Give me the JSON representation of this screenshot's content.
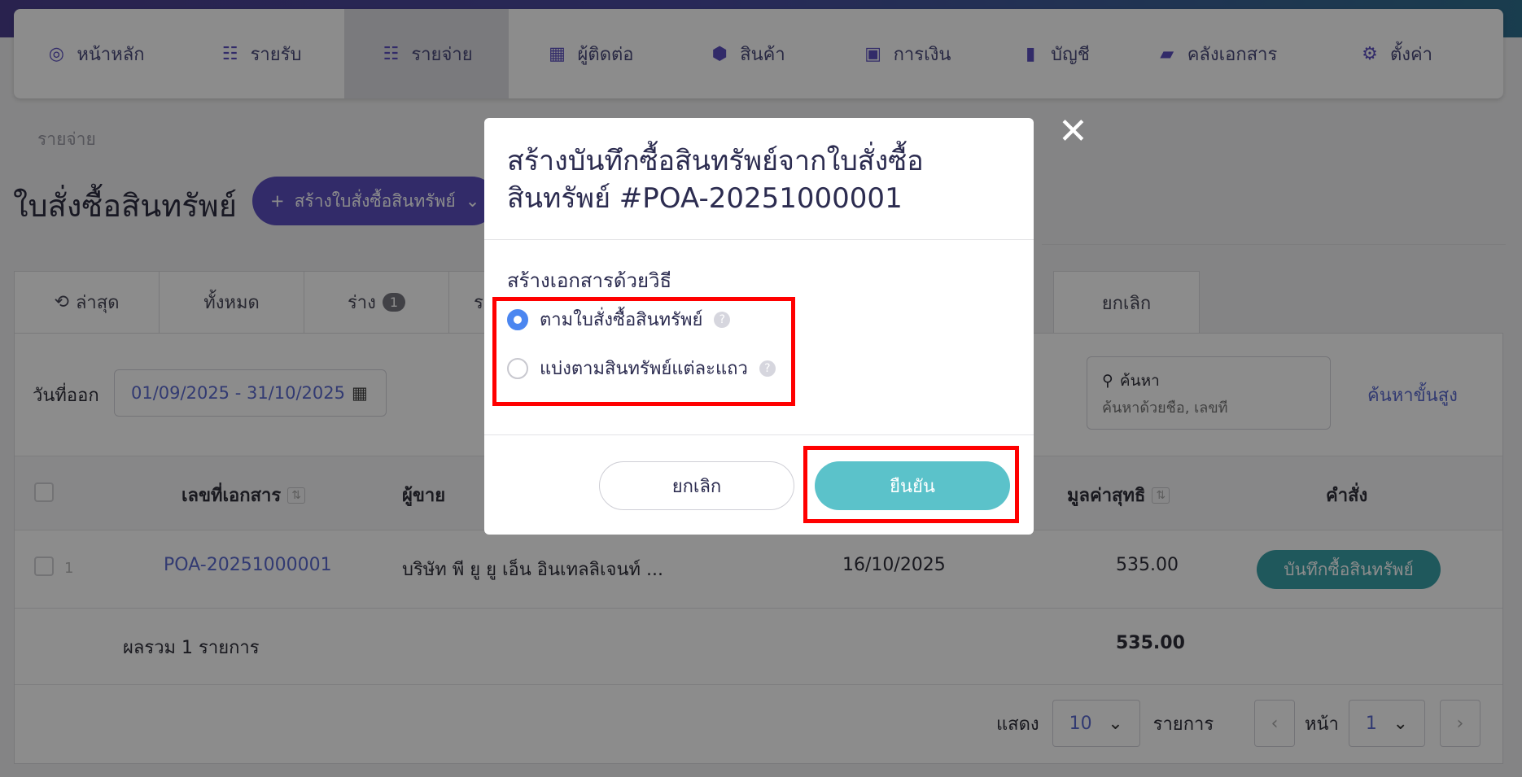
{
  "nav": {
    "items": [
      {
        "label": "หน้าหลัก",
        "icon": "dashboard-icon",
        "glyph": "◎"
      },
      {
        "label": "รายรับ",
        "icon": "income-icon",
        "glyph": "☷"
      },
      {
        "label": "รายจ่าย",
        "icon": "expense-icon",
        "glyph": "☷"
      },
      {
        "label": "ผู้ติดต่อ",
        "icon": "contacts-icon",
        "glyph": "▦"
      },
      {
        "label": "สินค้า",
        "icon": "product-box-icon",
        "glyph": "⬢"
      },
      {
        "label": "การเงิน",
        "icon": "money-icon",
        "glyph": "▣"
      },
      {
        "label": "บัญชี",
        "icon": "ledger-book-icon",
        "glyph": "▮"
      },
      {
        "label": "คลังเอกสาร",
        "icon": "folder-icon",
        "glyph": "▰"
      },
      {
        "label": "ตั้งค่า",
        "icon": "gear-icon",
        "glyph": "⚙"
      }
    ]
  },
  "breadcrumb": "รายจ่าย",
  "page_title": "ใบสั่งซื้อสินทรัพย์",
  "create_button": {
    "label": "สร้างใบสั่งซื้อสินทรัพย์",
    "plus": "+",
    "caret": "⌄"
  },
  "tabs": [
    {
      "label": "ล่าสุด",
      "icon": "⟲"
    },
    {
      "label": "ทั้งหมด"
    },
    {
      "label": "ร่าง",
      "badge": "1"
    },
    {
      "label": "ร"
    }
  ],
  "tab_cancel": "ยกเลิก",
  "filter": {
    "label": "วันที่ออก",
    "date_range": "01/09/2025 - 31/10/2025",
    "calendar_glyph": "▦"
  },
  "search": {
    "label": "ค้นหา",
    "placeholder": "ค้นหาด้วยชื่อ, เลขที่",
    "glyph": "⚲"
  },
  "advanced_search": "ค้นหาขั้นสูง",
  "table": {
    "headers": {
      "doc_no": "เลขที่เอกสาร",
      "vendor": "ผู้ขาย",
      "net_value": "มูลค่าสุทธิ",
      "action": "คำสั่ง"
    },
    "sort_glyph": "⇅",
    "rows": [
      {
        "index": "1",
        "doc_no": "POA-20251000001",
        "vendor": "บริษัท พี ยู ยู เอ็น อินเทลลิเจนท์ ...",
        "date": "16/10/2025",
        "net_value": "535.00",
        "action": "บันทึกซื้อสินทรัพย์"
      }
    ],
    "total_label": "ผลรวม 1 รายการ",
    "total_value": "535.00"
  },
  "pagination": {
    "show_label": "แสดง",
    "per_page": "10",
    "items_label": "รายการ",
    "page_label": "หน้า",
    "page": "1",
    "prev": "‹",
    "next": "›",
    "caret": "⌄"
  },
  "modal": {
    "title": "สร้างบันทึกซื้อสินทรัพย์จากใบสั่งซื้อสินทรัพย์ #POA-20251000001",
    "title_line1": "สร้างบันทึกซื้อสินทรัพย์จากใบสั่งซื้อ",
    "title_line2": "สินทรัพย์ #POA-20251000001",
    "section_label": "สร้างเอกสารด้วยวิธี",
    "options": [
      {
        "label": "ตามใบสั่งซื้อสินทรัพย์",
        "checked": true
      },
      {
        "label": "แบ่งตามสินทรัพย์แต่ละแถว",
        "checked": false
      }
    ],
    "help_glyph": "?",
    "cancel_label": "ยกเลิก",
    "confirm_label": "ยืนยัน",
    "close_glyph": "✕"
  },
  "colors": {
    "primary": "#5b4fc0",
    "teal": "#5bc2ca",
    "highlight": "#ff0000",
    "radio": "#4b86f0"
  }
}
